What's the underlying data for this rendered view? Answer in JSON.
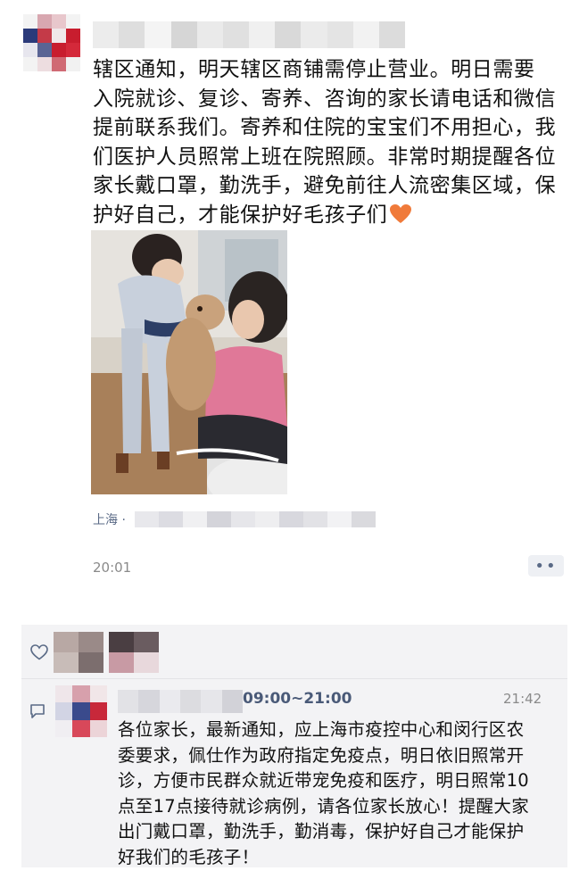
{
  "post": {
    "text": "辖区通知，明天辖区商铺需停止营业。明日需要\n入院就诊、复诊、寄养、咨询的家长请电话和微信\n提前联系我们。寄养和住院的宝宝们不用担心，我\n们医护人员照常上班在院照顾。非常时期提醒各位\n家长戴口罩，勤洗手，避免前往人流密集区域，保\n护好自己，才能保护好毛孩子们",
    "emoji": "heart-emoji",
    "location_prefix": "上海 ·",
    "time": "20:01",
    "more_label": "••"
  },
  "comment": {
    "hours": "09:00~21:00",
    "time": "21:42",
    "text": "各位家长，最新通知，应上海市疫控中心和闵行区农\n委要求，佩仕作为政府指定免疫点，明日依旧照常开\n诊，方便市民群众就近带宠免疫和医疗，明日照常10\n点至17点接待就诊病例，请各位家长放心！提醒大家\n出门戴口罩，勤洗手，勤消毒，保护好自己才能保护\n好我们的毛孩子！"
  },
  "icons": {
    "like": "heart-outline-icon",
    "comment": "comment-icon"
  },
  "colors": {
    "link": "#5a6a86",
    "interaction_bg": "#f3f3f5",
    "emoji": "#f07a3a"
  }
}
